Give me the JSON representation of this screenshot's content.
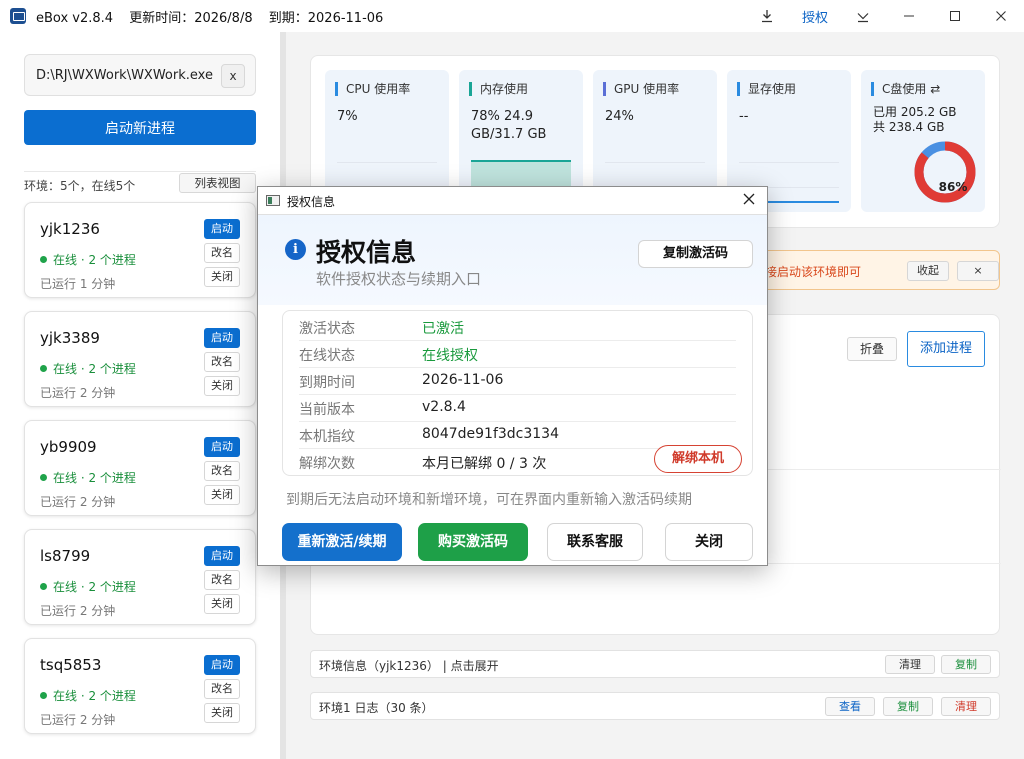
{
  "titlebar": {
    "app_name": "eBox v2.8.4",
    "update_time": "更新时间：2026/8/8",
    "expiry": "到期：2026-11-06",
    "download_icon": "download-icon",
    "auth_link": "授权",
    "minimize_glyph": "—",
    "maximize_glyph": "☐",
    "close_glyph": "✕",
    "chevron_glyph": "∨"
  },
  "sidebar": {
    "exe_path": "D:\\RJ\\WXWork\\WXWork.exe",
    "clear_label": "x",
    "launch_label": "启动新进程",
    "env_summary": "环境：5个，在线5个",
    "list_view_label": "列表视图",
    "envs": [
      {
        "name": "yjk1236",
        "status": "在线 · 2 个进程",
        "uptime": "已运行 1 分钟",
        "start": "启动",
        "rename": "改名",
        "close": "关闭"
      },
      {
        "name": "yjk3389",
        "status": "在线 · 2 个进程",
        "uptime": "已运行 2 分钟",
        "start": "启动",
        "rename": "改名",
        "close": "关闭"
      },
      {
        "name": "yb9909",
        "status": "在线 · 2 个进程",
        "uptime": "已运行 2 分钟",
        "start": "启动",
        "rename": "改名",
        "close": "关闭"
      },
      {
        "name": "ls8799",
        "status": "在线 · 2 个进程",
        "uptime": "已运行 2 分钟",
        "start": "启动",
        "rename": "改名",
        "close": "关闭"
      },
      {
        "name": "tsq5853",
        "status": "在线 · 2 个进程",
        "uptime": "已运行 2 分钟",
        "start": "启动",
        "rename": "改名",
        "close": "关闭"
      }
    ]
  },
  "stats": {
    "cpu": {
      "title": "CPU 使用率",
      "value": "7%",
      "color": "#2a8be0"
    },
    "mem": {
      "title": "内存使用",
      "value1": "78%  24.9",
      "value2": "GB/31.7 GB",
      "color": "#1aa596"
    },
    "gpu": {
      "title": "GPU 使用率",
      "value": "24%",
      "color": "#5b6fd6"
    },
    "vram": {
      "title": "显存使用",
      "value": "--",
      "color": "#2a8be0"
    },
    "disk": {
      "title": "C盘使用 ⇄",
      "used": "已用 205.2 GB",
      "total": "共 238.4 GB",
      "percent": 86,
      "percent_label": "86%",
      "used_color": "#e03b35",
      "free_color": "#4a90e2"
    }
  },
  "alert": {
    "text": "接启动该环境即可",
    "collapse_label": "收起",
    "close_label": "×"
  },
  "process_panel": {
    "fold_label": "折叠",
    "add_label": "添加进程"
  },
  "env_info_bar": {
    "text": "环境信息（yjk1236） | 点击展开",
    "clear_label": "清理",
    "copy_label": "复制"
  },
  "log_bar": {
    "text": "环境1 日志（30 条）",
    "view_label": "查看",
    "copy_label": "复制",
    "clear_label": "清理"
  },
  "dialog": {
    "window_title": "授权信息",
    "heading": "授权信息",
    "subtitle": "软件授权状态与续期入口",
    "copy_code_label": "复制激活码",
    "rows": [
      {
        "label": "激活状态",
        "value": "已激活"
      },
      {
        "label": "在线状态",
        "value": "在线授权"
      },
      {
        "label": "到期时间",
        "value": "2026-11-06"
      },
      {
        "label": "当前版本",
        "value": "v2.8.4"
      },
      {
        "label": "本机指纹",
        "value": "8047de91f3dc3134"
      },
      {
        "label": "解绑次数",
        "value": "本月已解绑 0 / 3 次"
      }
    ],
    "unbind_label": "解绑本机",
    "note": "到期后无法启动环境和新增环境，可在界面内重新输入激活码续期",
    "reactivate_label": "重新激活/续期",
    "buy_label": "购买激活码",
    "support_label": "联系客服",
    "close_label": "关闭"
  }
}
